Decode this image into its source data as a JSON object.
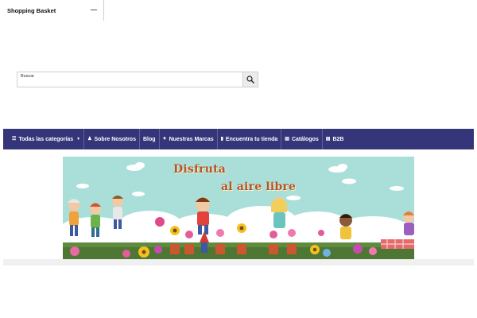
{
  "basket": {
    "title": "Shopping Basket"
  },
  "search": {
    "placeholder": "Buscar"
  },
  "nav": {
    "items": [
      {
        "label": "Todas las categorías",
        "icon": "menu-icon"
      },
      {
        "label": "Sobre Nosotros",
        "icon": "people-icon"
      },
      {
        "label": "Blog"
      },
      {
        "label": "Nuestras Marcas",
        "icon": "star-icon"
      },
      {
        "label": "Encuentra tu tienda",
        "icon": "document-icon"
      },
      {
        "label": "Catálogos",
        "icon": "document-icon"
      },
      {
        "label": "B2B",
        "icon": "document-icon"
      }
    ]
  },
  "banner": {
    "line1": "Disfruta",
    "line2": "al aire libre"
  },
  "colors": {
    "navbar": "#35357a",
    "banner_sky": "#a9dfd8",
    "banner_text": "#b5542a"
  }
}
